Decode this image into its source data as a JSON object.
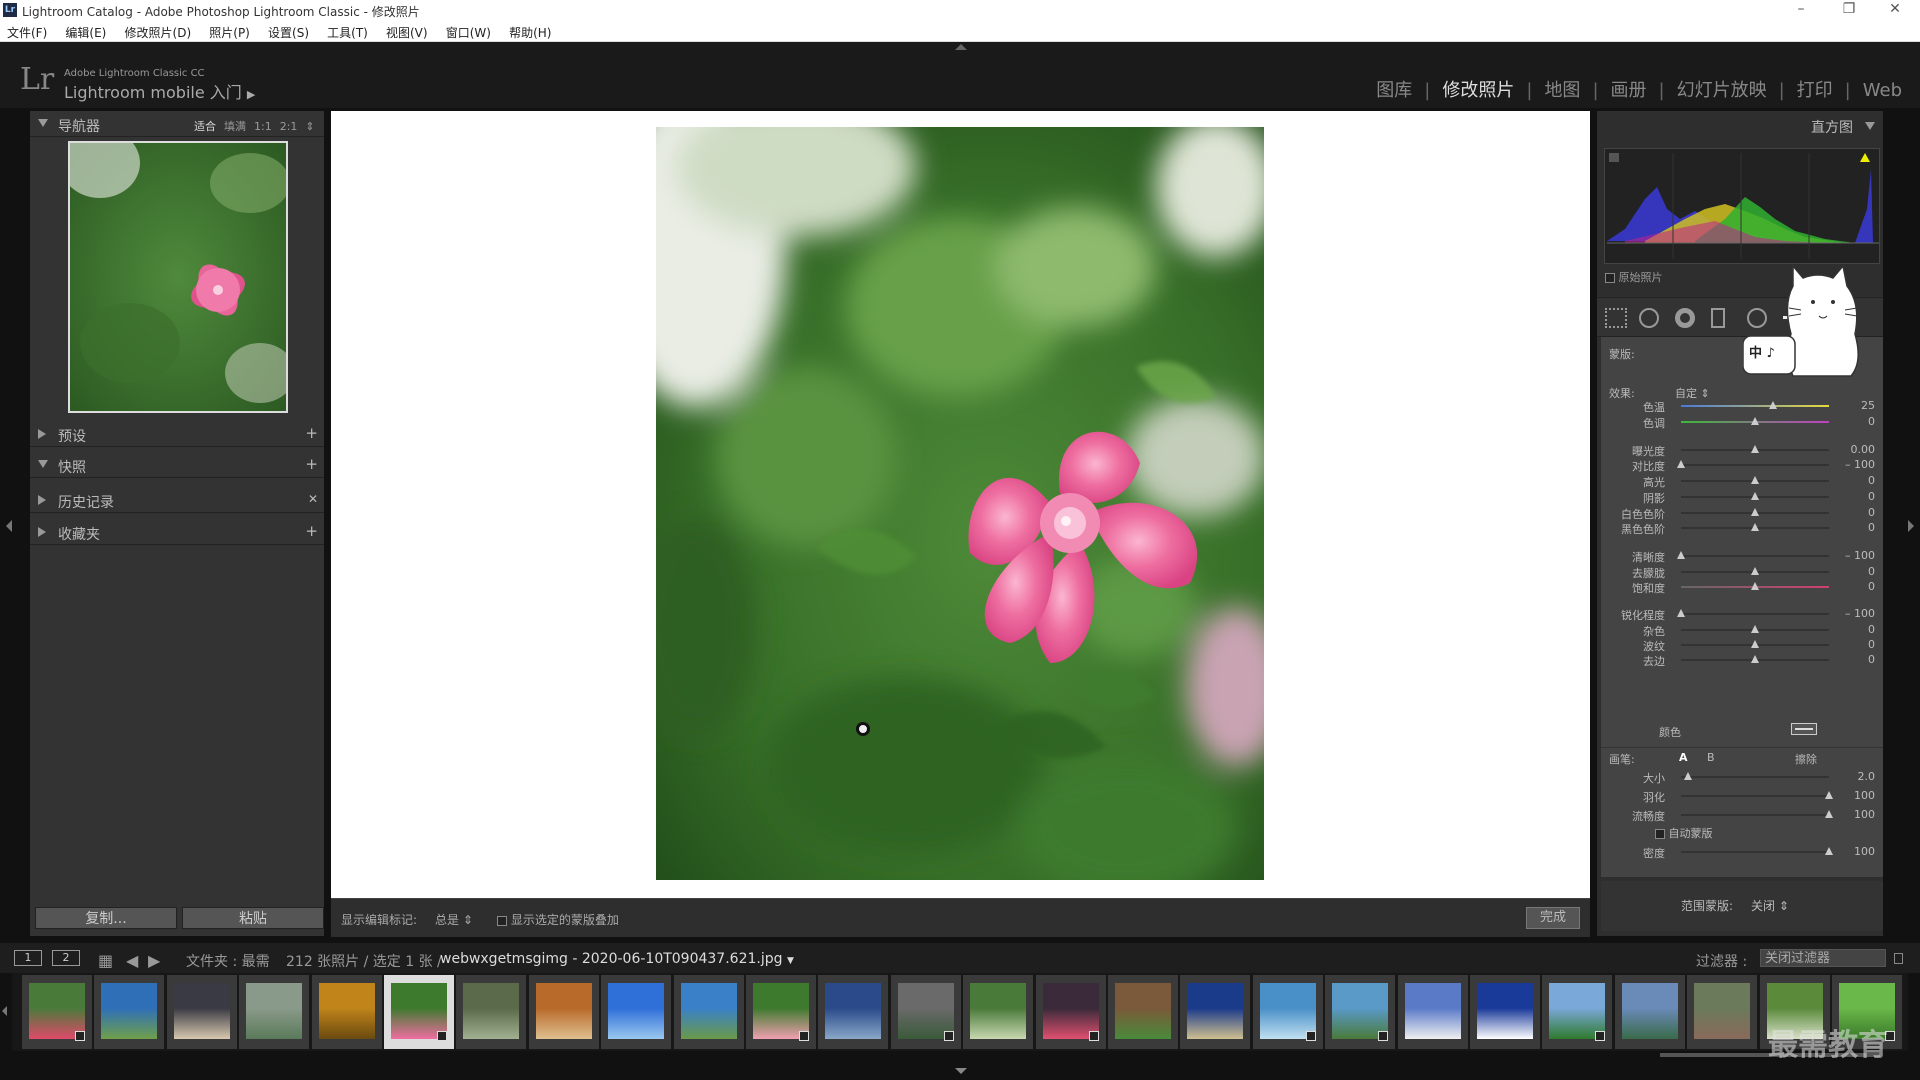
{
  "window": {
    "title": "Lightroom Catalog - Adobe Photoshop Lightroom Classic - 修改照片",
    "app_badge": "Lr"
  },
  "menu": [
    "文件(F)",
    "编辑(E)",
    "修改照片(D)",
    "照片(P)",
    "设置(S)",
    "工具(T)",
    "视图(V)",
    "窗口(W)",
    "帮助(H)"
  ],
  "identity": {
    "logo": "Lr",
    "product": "Adobe Lightroom Classic CC",
    "mobile": "Lightroom mobile 入门"
  },
  "modules": [
    "图库",
    "修改照片",
    "地图",
    "画册",
    "幻灯片放映",
    "打印",
    "Web"
  ],
  "active_module": "修改照片",
  "left": {
    "navigator": {
      "label": "导航器",
      "zoom": [
        "适合",
        "填满",
        "1:1",
        "2:1"
      ]
    },
    "presets": {
      "label": "预设"
    },
    "snapshots": {
      "label": "快照"
    },
    "history": {
      "label": "历史记录"
    },
    "collections": {
      "label": "收藏夹"
    },
    "copy_label": "复制...",
    "paste_label": "粘贴"
  },
  "toolbar": {
    "show_pins_label": "显示编辑标记:",
    "show_pins_value": "总是",
    "overlay_label": "显示选定的蒙版叠加",
    "done_label": "完成"
  },
  "right": {
    "histogram_label": "直方图",
    "original_label": "原始照片",
    "mask_label": "蒙版:",
    "effect_label": "效果:",
    "effect_value": "自定",
    "sliders": [
      {
        "label": "色温",
        "value": "25",
        "pos": 0.62
      },
      {
        "label": "色调",
        "value": "0",
        "pos": 0.5
      },
      {
        "label": "曝光度",
        "value": "0.00",
        "pos": 0.5
      },
      {
        "label": "对比度",
        "value": "– 100",
        "pos": 0.0
      },
      {
        "label": "高光",
        "value": "0",
        "pos": 0.5
      },
      {
        "label": "阴影",
        "value": "0",
        "pos": 0.5
      },
      {
        "label": "白色色阶",
        "value": "0",
        "pos": 0.5
      },
      {
        "label": "黑色色阶",
        "value": "0",
        "pos": 0.5
      },
      {
        "label": "清晰度",
        "value": "– 100",
        "pos": 0.0
      },
      {
        "label": "去朦胧",
        "value": "0",
        "pos": 0.5
      },
      {
        "label": "饱和度",
        "value": "0",
        "pos": 0.5
      },
      {
        "label": "锐化程度",
        "value": "– 100",
        "pos": 0.0
      },
      {
        "label": "杂色",
        "value": "0",
        "pos": 0.5
      },
      {
        "label": "波纹",
        "value": "0",
        "pos": 0.5
      },
      {
        "label": "去边",
        "value": "0",
        "pos": 0.5
      }
    ],
    "color_label": "颜色",
    "brush": {
      "label": "画笔:",
      "a": "A",
      "b": "B",
      "erase": "擦除",
      "size_label": "大小",
      "size_value": "2.0",
      "size_pos": 0.05,
      "feather_label": "羽化",
      "feather_value": "100",
      "feather_pos": 1.0,
      "flow_label": "流畅度",
      "flow_value": "100",
      "flow_pos": 1.0,
      "automask_label": "自动蒙版",
      "density_label": "密度",
      "density_value": "100",
      "density_pos": 1.0
    },
    "range_mask_label": "范围蒙版:",
    "range_mask_value": "关闭",
    "mascot_text": "中 ♪"
  },
  "filmbar": {
    "page1": "1",
    "page2": "2",
    "source": "文件夹 : 最需",
    "count": "212 张照片 / 选定 1 张 /",
    "filename": "webwxgetmsgimg - 2020-06-10T090437.621.jpg",
    "filter_label": "过滤器 :",
    "filter_value": "关闭过滤器"
  },
  "filmstrip": {
    "count": 26,
    "selected": 5
  },
  "watermark": "最需教育"
}
